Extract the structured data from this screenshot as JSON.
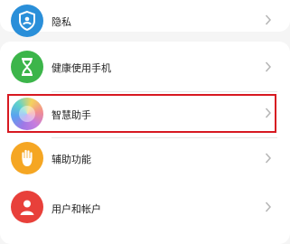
{
  "settings_items": [
    {
      "label": "隐私",
      "icon": "privacy-shield-icon"
    },
    {
      "label": "健康使用手机",
      "icon": "hourglass-icon"
    },
    {
      "label": "智慧助手",
      "icon": "smart-assistant-icon"
    },
    {
      "label": "辅助功能",
      "icon": "accessibility-hand-icon"
    },
    {
      "label": "用户和帐户",
      "icon": "user-icon"
    }
  ],
  "colors": {
    "privacy": "#2a8fd9",
    "health": "#3cb54a",
    "assistant": "#9f78e6",
    "accessibility": "#f5a623",
    "user": "#e8403a",
    "highlight": "#d71921"
  }
}
